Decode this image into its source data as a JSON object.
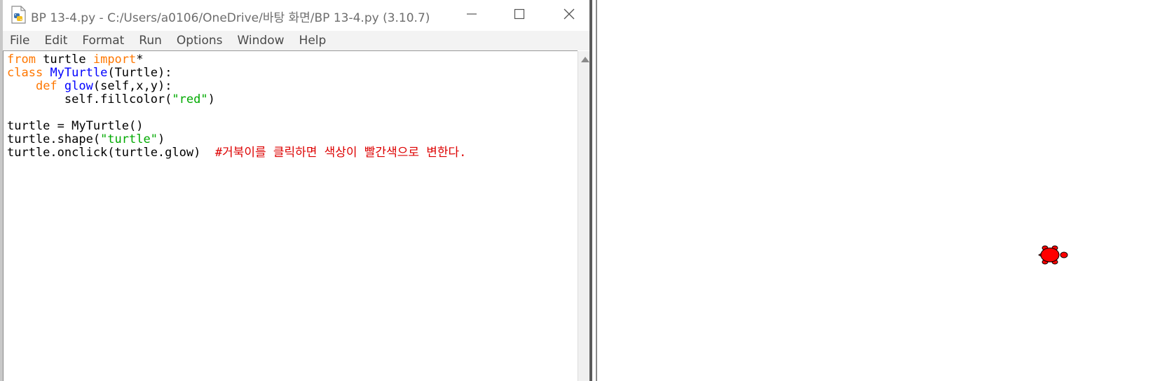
{
  "window": {
    "title": "BP 13-4.py - C:/Users/a0106/OneDrive/바탕 화면/BP 13-4.py (3.10.7)",
    "icon": "python-file-icon",
    "controls": {
      "minimize": "minimize-icon",
      "maximize": "maximize-icon",
      "close": "close-icon"
    }
  },
  "menu": {
    "items": [
      "File",
      "Edit",
      "Format",
      "Run",
      "Options",
      "Window",
      "Help"
    ]
  },
  "editor": {
    "lines": [
      [
        {
          "t": "from",
          "c": "kw"
        },
        {
          "t": " turtle ",
          "c": ""
        },
        {
          "t": "import",
          "c": "kw"
        },
        {
          "t": "*",
          "c": ""
        }
      ],
      [
        {
          "t": "class",
          "c": "kw"
        },
        {
          "t": " ",
          "c": ""
        },
        {
          "t": "MyTurtle",
          "c": "def"
        },
        {
          "t": "(Turtle):",
          "c": ""
        }
      ],
      [
        {
          "t": "    ",
          "c": ""
        },
        {
          "t": "def",
          "c": "kw"
        },
        {
          "t": " ",
          "c": ""
        },
        {
          "t": "glow",
          "c": "def"
        },
        {
          "t": "(self,x,y):",
          "c": ""
        }
      ],
      [
        {
          "t": "        self.fillcolor(",
          "c": ""
        },
        {
          "t": "\"red\"",
          "c": "str"
        },
        {
          "t": ")",
          "c": ""
        }
      ],
      [
        {
          "t": "",
          "c": ""
        }
      ],
      [
        {
          "t": "turtle = MyTurtle()",
          "c": ""
        }
      ],
      [
        {
          "t": "turtle.shape(",
          "c": ""
        },
        {
          "t": "\"turtle\"",
          "c": "str"
        },
        {
          "t": ")",
          "c": ""
        }
      ],
      [
        {
          "t": "turtle.onclick(turtle.glow)  ",
          "c": ""
        },
        {
          "t": "#거북이를 클릭하면 색상이 빨간색으로 변한다.",
          "c": "cmt"
        }
      ]
    ]
  },
  "turtle_canvas": {
    "turtle": {
      "shape": "turtle",
      "fill_color": "#ff0000",
      "outline_color": "#000000"
    }
  }
}
